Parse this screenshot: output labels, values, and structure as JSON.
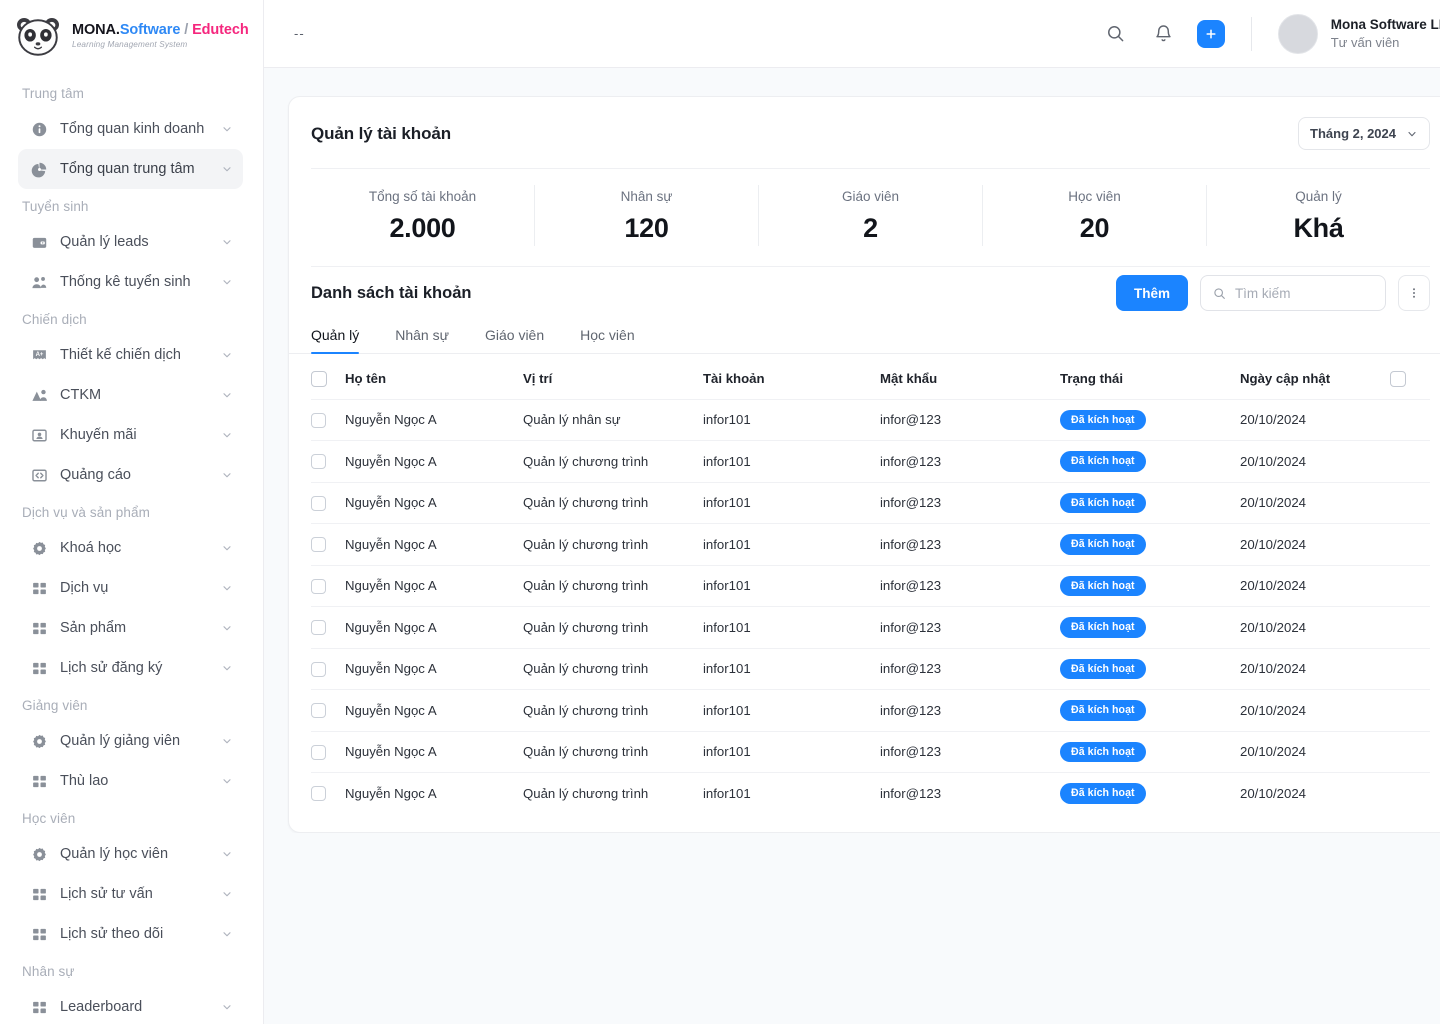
{
  "brand": {
    "logo_icon": "panda-icon",
    "name_mona": "MONA.",
    "name_software": "Software",
    "name_slash": "/",
    "name_edutech": "Edutech",
    "tagline": "Learning Management System",
    "accent_blue": "#1b84ff",
    "accent_pink": "#f5277e"
  },
  "sidebar": {
    "groups": [
      {
        "title": "Trung tâm",
        "items": [
          {
            "label": "Tổng quan kinh doanh",
            "icon": "info-circle-icon",
            "active": false
          },
          {
            "label": "Tổng quan trung tâm",
            "icon": "pie-chart-icon",
            "active": true
          }
        ]
      },
      {
        "title": "Tuyển sinh",
        "items": [
          {
            "label": "Quản lý leads",
            "icon": "wallet-icon",
            "active": false
          },
          {
            "label": "Thống kê tuyển sinh",
            "icon": "users-group-icon",
            "active": false
          }
        ]
      },
      {
        "title": "Chiến dịch",
        "items": [
          {
            "label": "Thiết kế chiến dịch",
            "icon": "ad-badge-icon",
            "active": false
          },
          {
            "label": "CTKM",
            "icon": "megaphone-user-icon",
            "active": false
          },
          {
            "label": "Khuyến mãi",
            "icon": "id-card-icon",
            "active": false
          },
          {
            "label": "Quảng cáo",
            "icon": "code-brackets-icon",
            "active": false
          }
        ]
      },
      {
        "title": "Dịch vụ và sản phẩm",
        "items": [
          {
            "label": "Khoá học",
            "icon": "gear-icon",
            "active": false
          },
          {
            "label": "Dịch vụ",
            "icon": "grid-icon",
            "active": false
          },
          {
            "label": "Sản phẩm",
            "icon": "grid-icon",
            "active": false
          },
          {
            "label": "Lịch sử đăng ký",
            "icon": "grid-icon",
            "active": false
          }
        ]
      },
      {
        "title": "Giảng viên",
        "items": [
          {
            "label": "Quản lý giảng viên",
            "icon": "gear-icon",
            "active": false
          },
          {
            "label": "Thù lao",
            "icon": "grid-icon",
            "active": false
          }
        ]
      },
      {
        "title": "Học viên",
        "items": [
          {
            "label": "Quản lý học viên",
            "icon": "gear-icon",
            "active": false
          },
          {
            "label": "Lịch sử tư vấn",
            "icon": "grid-icon",
            "active": false
          },
          {
            "label": "Lịch sử theo dõi",
            "icon": "grid-icon",
            "active": false
          }
        ]
      },
      {
        "title": "Nhân sự",
        "items": [
          {
            "label": "Leaderboard",
            "icon": "grid-icon",
            "active": false
          }
        ]
      }
    ]
  },
  "topbar": {
    "breadcrumb": "--",
    "search_icon": "search-icon",
    "bell_icon": "bell-icon",
    "add_icon": "plus-icon",
    "user_name": "Mona Software LMS",
    "user_role": "Tư vấn viên",
    "avatar_icon": "avatar"
  },
  "account_card": {
    "title": "Quản lý tài khoản",
    "month_filter": {
      "value": "Tháng 2, 2024",
      "chevron_icon": "chevron-down-icon"
    },
    "stats": [
      {
        "label": "Tổng số tài khoản",
        "value": "2.000"
      },
      {
        "label": "Nhân sự",
        "value": "120"
      },
      {
        "label": "Giáo viên",
        "value": "2"
      },
      {
        "label": "Học viên",
        "value": "20"
      },
      {
        "label": "Quản lý",
        "value": "Khá"
      }
    ],
    "list": {
      "title": "Danh sách tài khoản",
      "add_label": "Thêm",
      "search_placeholder": "Tìm kiếm",
      "search_value": "",
      "search_icon": "search-icon",
      "more_icon": "kebab-menu-icon",
      "tabs": [
        {
          "label": "Quản lý",
          "active": true
        },
        {
          "label": "Nhân sự",
          "active": false
        },
        {
          "label": "Giáo viên",
          "active": false
        },
        {
          "label": "Học viên",
          "active": false
        }
      ],
      "columns": [
        "Họ tên",
        "Vị trí",
        "Tài khoản",
        "Mật khẩu",
        "Trạng thái",
        "Ngày cập nhật"
      ],
      "rows": [
        {
          "name": "Nguyễn Ngọc A",
          "position": "Quản lý nhân sự",
          "account": "infor101",
          "password": "infor@123",
          "status": "Đã kích hoạt",
          "updated": "20/10/2024"
        },
        {
          "name": "Nguyễn Ngọc A",
          "position": "Quản lý chương trình",
          "account": "infor101",
          "password": "infor@123",
          "status": "Đã kích hoạt",
          "updated": "20/10/2024"
        },
        {
          "name": "Nguyễn Ngọc A",
          "position": "Quản lý chương trình",
          "account": "infor101",
          "password": "infor@123",
          "status": "Đã kích hoạt",
          "updated": "20/10/2024"
        },
        {
          "name": "Nguyễn Ngọc A",
          "position": "Quản lý chương trình",
          "account": "infor101",
          "password": "infor@123",
          "status": "Đã kích hoạt",
          "updated": "20/10/2024"
        },
        {
          "name": "Nguyễn Ngọc A",
          "position": "Quản lý chương trình",
          "account": "infor101",
          "password": "infor@123",
          "status": "Đã kích hoạt",
          "updated": "20/10/2024"
        },
        {
          "name": "Nguyễn Ngọc A",
          "position": "Quản lý chương trình",
          "account": "infor101",
          "password": "infor@123",
          "status": "Đã kích hoạt",
          "updated": "20/10/2024"
        },
        {
          "name": "Nguyễn Ngọc A",
          "position": "Quản lý chương trình",
          "account": "infor101",
          "password": "infor@123",
          "status": "Đã kích hoạt",
          "updated": "20/10/2024"
        },
        {
          "name": "Nguyễn Ngọc A",
          "position": "Quản lý chương trình",
          "account": "infor101",
          "password": "infor@123",
          "status": "Đã kích hoạt",
          "updated": "20/10/2024"
        },
        {
          "name": "Nguyễn Ngọc A",
          "position": "Quản lý chương trình",
          "account": "infor101",
          "password": "infor@123",
          "status": "Đã kích hoạt",
          "updated": "20/10/2024"
        },
        {
          "name": "Nguyễn Ngọc A",
          "position": "Quản lý chương trình",
          "account": "infor101",
          "password": "infor@123",
          "status": "Đã kích hoạt",
          "updated": "20/10/2024"
        }
      ]
    }
  }
}
